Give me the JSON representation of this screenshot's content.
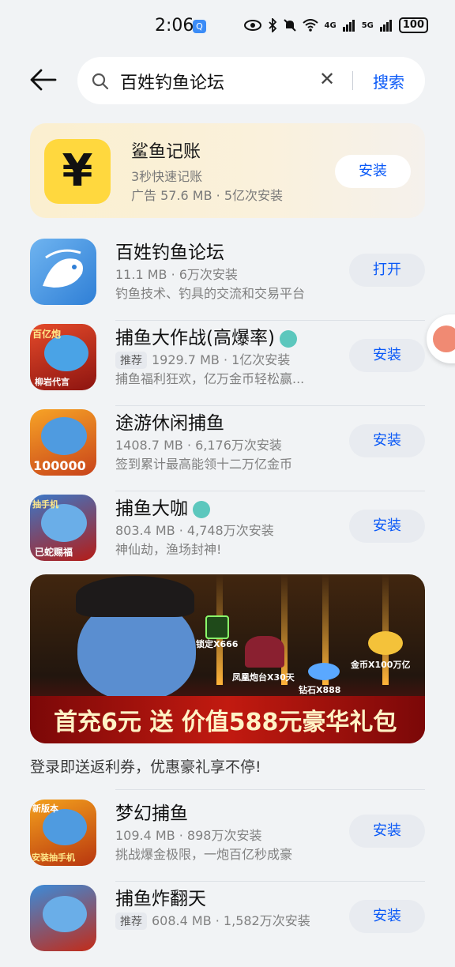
{
  "status_bar": {
    "time": "2:06",
    "q_badge": "Q",
    "battery": "100",
    "net1": "4G",
    "net2": "5G"
  },
  "search": {
    "query": "百姓钓鱼论坛",
    "clear_glyph": "✕",
    "submit_label": "搜索"
  },
  "ad": {
    "name": "鲨鱼记账",
    "tagline": "3秒快速记账",
    "meta": "广告 57.6 MB · 5亿次安装",
    "button": "安装",
    "icon_glyph": "¥",
    "icon": "yen-icon",
    "bg_color": "#fbefcf"
  },
  "apps": [
    {
      "name": "百姓钓鱼论坛",
      "meta": "11.1 MB · 6万次安装",
      "desc": "钓鱼技术、钓具的交流和交易平台",
      "button": "打开",
      "tag": "",
      "verified": false,
      "icon_text": "",
      "icon": "fishing-forum-icon"
    },
    {
      "name": "捕鱼大作战(高爆率)",
      "meta": "1929.7 MB · 1亿次安装",
      "desc": "捕鱼福利狂欢，亿万金币轻松赢...",
      "button": "安装",
      "tag": "推荐",
      "verified": true,
      "icon_text": "百亿炮",
      "icon_text2": "柳岩代言",
      "icon": "fish-game-icon"
    },
    {
      "name": "途游休闲捕鱼",
      "meta": "1408.7 MB · 6,176万次安装",
      "desc": "签到累计最高能领十二万亿金币",
      "button": "安装",
      "tag": "",
      "verified": false,
      "icon_text": "100000",
      "icon": "fish-game-icon"
    },
    {
      "name": "捕鱼大咖",
      "meta": "803.4 MB · 4,748万次安装",
      "desc": "神仙劫，渔场封神!",
      "button": "安装",
      "tag": "",
      "verified": true,
      "icon_text": "抽手机",
      "icon_text2": "已蛇赐福",
      "icon": "fish-game-icon"
    }
  ],
  "banner": {
    "promo_text": "首充6元 送 价值588元豪华礼包",
    "labels": [
      "锁定X666",
      "凤凰炮台X30天",
      "钻石X888",
      "金币X100万亿"
    ],
    "caption": "登录即送返利券，优惠豪礼享不停!"
  },
  "apps2": [
    {
      "name": "梦幻捕鱼",
      "meta": "109.4 MB · 898万次安装",
      "desc": "挑战爆金极限，一炮百亿秒成豪",
      "button": "安装",
      "tag": "",
      "icon_text": "新版本",
      "icon_text2": "安装抽手机",
      "icon": "fish-game-icon"
    },
    {
      "name": "捕鱼炸翻天",
      "meta": "608.4 MB · 1,582万次安装",
      "desc": "",
      "button": "安装",
      "tag": "推荐",
      "icon_text": "",
      "icon": "fish-game-icon"
    }
  ],
  "colors": {
    "accent": "#0a59f7",
    "background": "#f1f3f5",
    "button_bg": "#e8ebf0"
  }
}
